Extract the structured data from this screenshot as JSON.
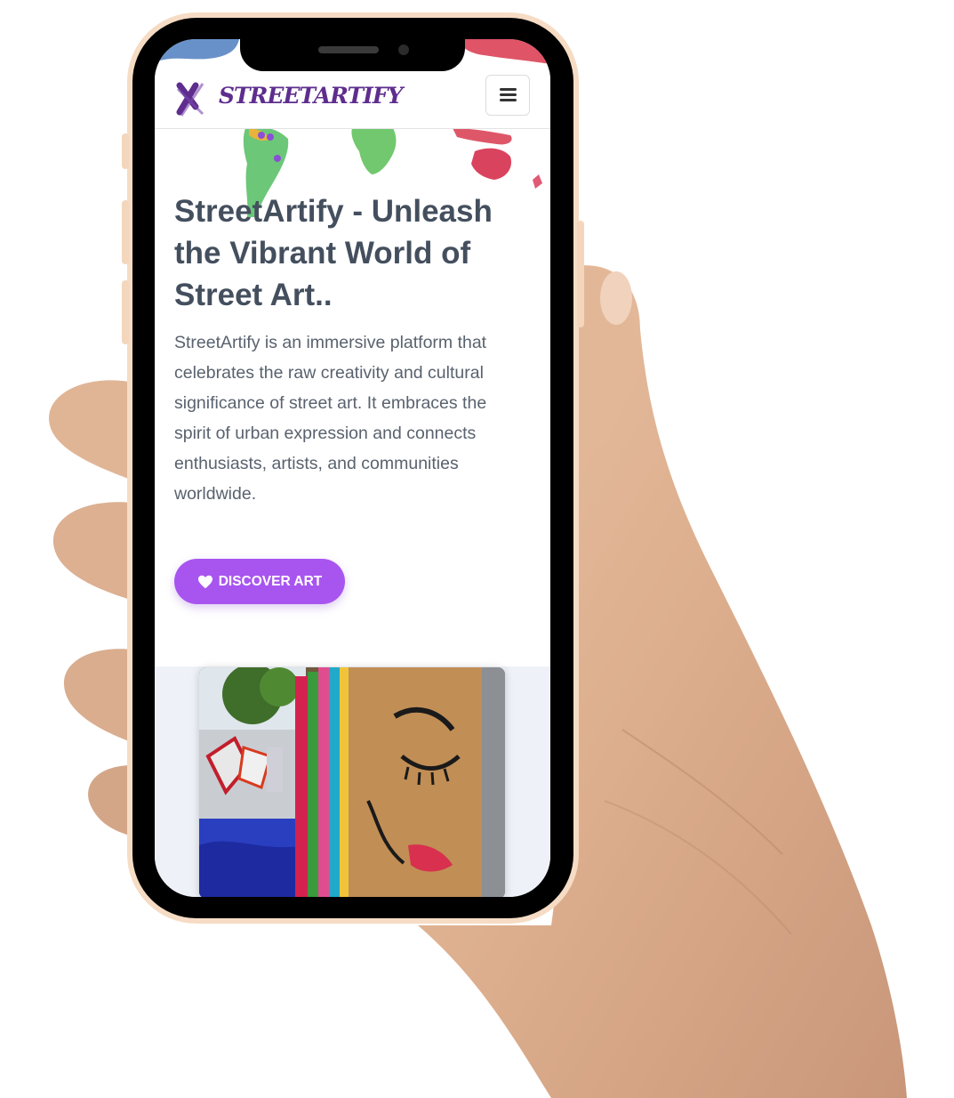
{
  "app": {
    "brand": "STREETARTIFY"
  },
  "navbar": {
    "menu_icon": "hamburger-menu-icon"
  },
  "hero": {
    "title": "StreetArtify - Unleash the Vibrant World of Street Art..",
    "description": "StreetArtify is an immersive platform that celebrates the raw creativity and cultural significance of street art. It embraces the spirit of urban expression and connects enthusiasts, artists, and communities worldwide.",
    "cta_label": "DISCOVER ART",
    "cta_icon": "heart-icon"
  },
  "colors": {
    "accent": "#a855f0",
    "brand_purple": "#5e2d8e",
    "heading": "#444f5e",
    "body_text": "#59626e",
    "phone_frame": "#f6dcc4"
  }
}
